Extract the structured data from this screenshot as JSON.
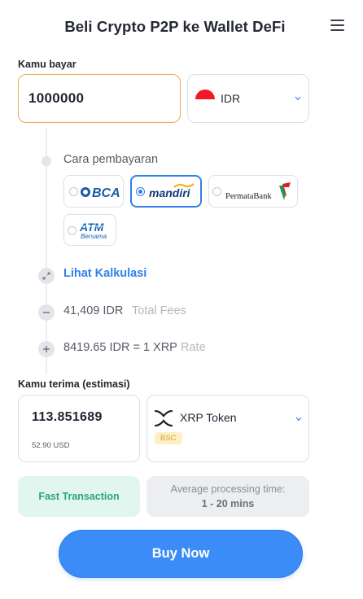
{
  "header": {
    "title": "Beli Crypto P2P ke Wallet DeFi",
    "menu_icon": "hamburger-menu-icon"
  },
  "pay": {
    "label": "Kamu bayar",
    "amount": "1000000",
    "currency": "IDR",
    "flag_icon": "indonesia-flag-icon"
  },
  "payment_method": {
    "label": "Cara pembayaran",
    "options": [
      {
        "name": "BCA",
        "selected": false
      },
      {
        "name": "mandiri",
        "selected": true
      },
      {
        "name": "PermataBank",
        "selected": false
      },
      {
        "name": "ATM Bersama",
        "selected": false
      }
    ]
  },
  "calculation": {
    "toggle_label": "Lihat Kalkulasi",
    "fees_value": "41,409 IDR",
    "fees_label": "Total Fees",
    "rate_value": "8419.65 IDR = 1 XRP",
    "rate_label": "Rate"
  },
  "receive": {
    "label": "Kamu terima (estimasi)",
    "amount": "113.851689",
    "usd": "52.90 USD",
    "token": "XRP Token",
    "network": "BSC",
    "token_icon": "xrp-icon"
  },
  "info": {
    "fast_label": "Fast Transaction",
    "processing_label": "Average processing time:",
    "processing_value": "1 - 20 mins"
  },
  "cta": {
    "label": "Buy Now"
  },
  "colors": {
    "accent": "#3b8cf7",
    "input_focus": "#f0a94e",
    "fast_bg": "#e0f6ef",
    "fast_text": "#2fa184"
  }
}
